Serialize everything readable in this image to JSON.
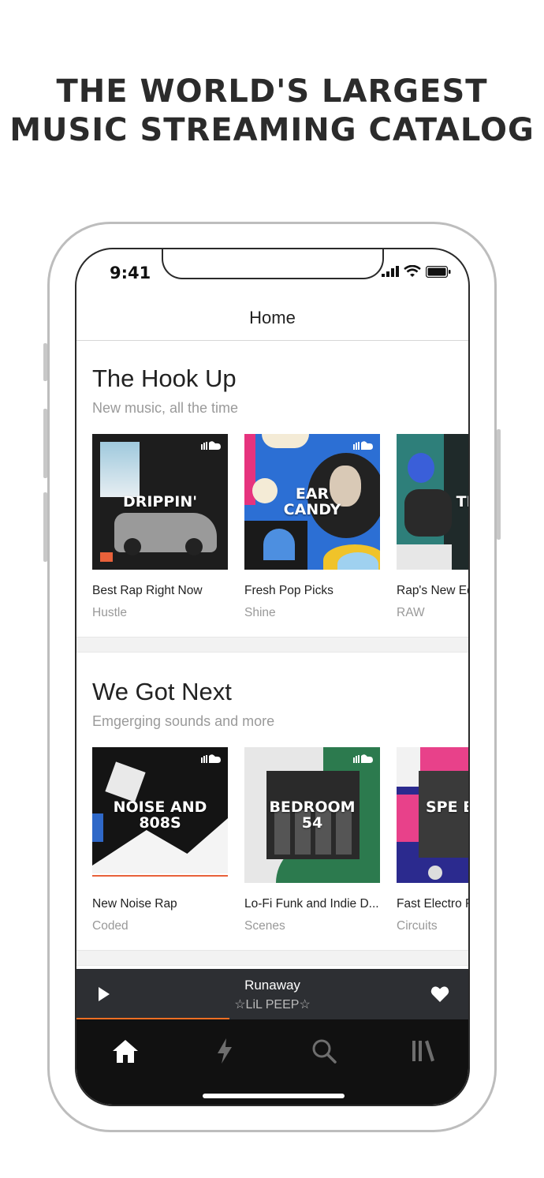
{
  "headline": {
    "line1": "THE WORLD'S LARGEST",
    "line2": "MUSIC STREAMING CATALOG"
  },
  "status_bar": {
    "time": "9:41"
  },
  "header": {
    "title": "Home"
  },
  "sections": [
    {
      "title": "The Hook Up",
      "subtitle": "New music, all the time",
      "cards": [
        {
          "title": "Best Rap Right Now",
          "subtitle": "Hustle",
          "art_text": "DRIPPIN'"
        },
        {
          "title": "Fresh Pop Picks",
          "subtitle": "Shine",
          "art_text": "EAR CANDY"
        },
        {
          "title": "Rap's New Ed",
          "subtitle": "RAW",
          "art_text": "TEA"
        }
      ]
    },
    {
      "title": "We Got Next",
      "subtitle": "Emgerging sounds and more",
      "cards": [
        {
          "title": "New Noise Rap",
          "subtitle": "Coded",
          "art_text": "NOISE AND 808S"
        },
        {
          "title": "Lo-Fi Funk and Indie D...",
          "subtitle": "Scenes",
          "art_text": "BEDROOM 54"
        },
        {
          "title": "Fast Electro F",
          "subtitle": "Circuits",
          "art_text": "SPE BUM"
        }
      ]
    }
  ],
  "player": {
    "track": "Runaway",
    "artist": "☆LiL PEEP☆",
    "progress": 0.39
  },
  "tabs": [
    {
      "name": "home",
      "icon": "home-icon"
    },
    {
      "name": "stream",
      "icon": "lightning-icon"
    },
    {
      "name": "search",
      "icon": "search-icon"
    },
    {
      "name": "library",
      "icon": "library-icon"
    }
  ],
  "colors": {
    "accent": "#f26f23",
    "player_bg": "#2d2f33",
    "tabbar_bg": "#111111"
  }
}
